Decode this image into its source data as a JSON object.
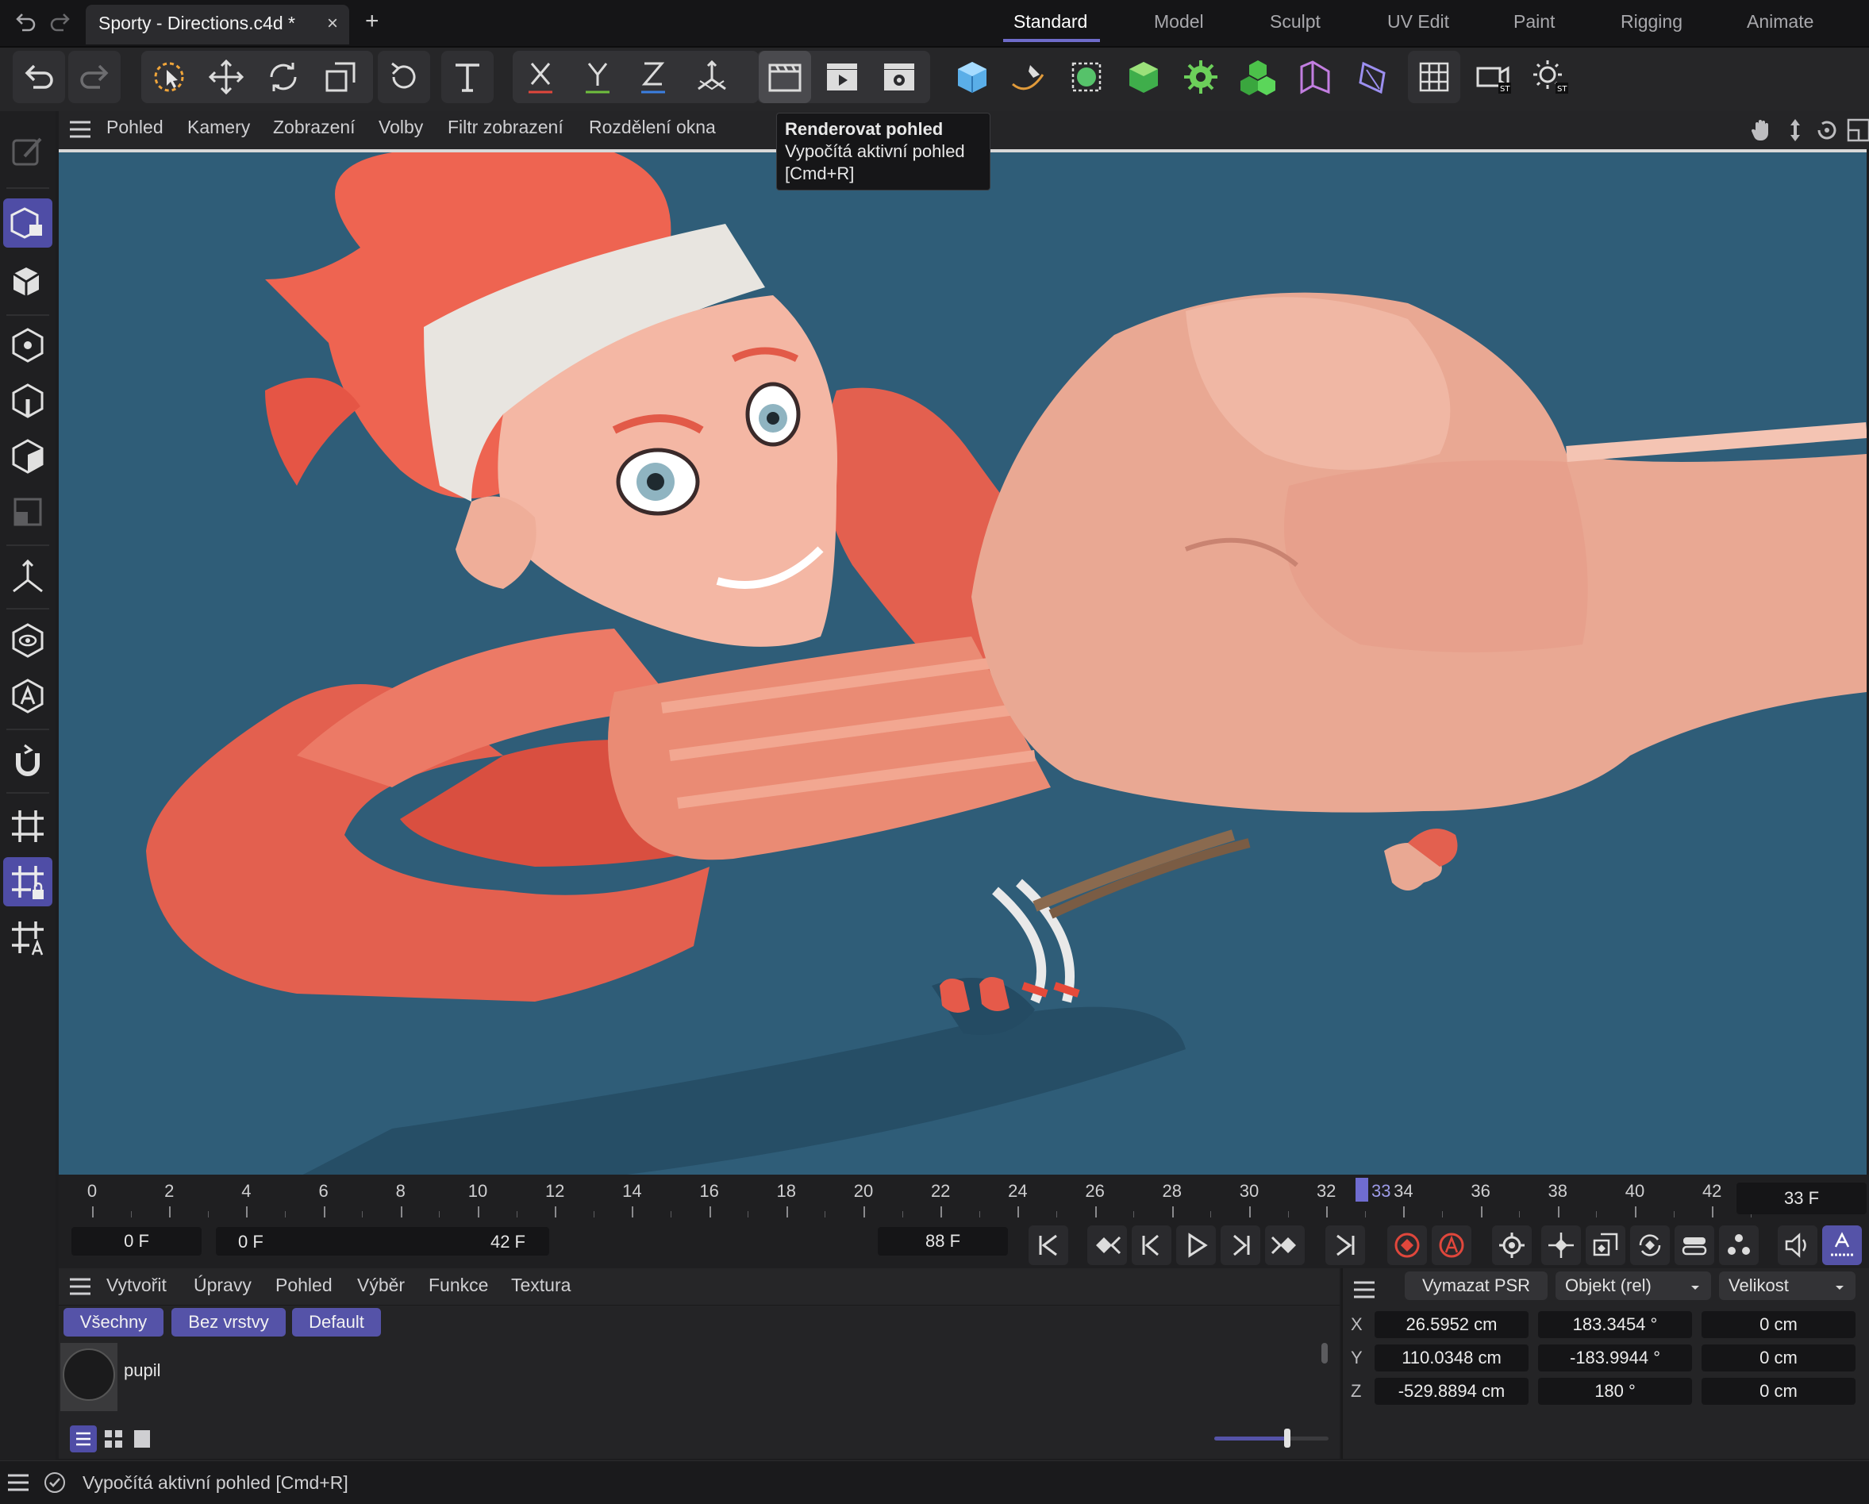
{
  "titlebar": {
    "doc_title": "Sporty - Directions.c4d *",
    "close_glyph": "×",
    "add_glyph": "+",
    "workspaces": [
      "Standard",
      "Model",
      "Sculpt",
      "UV Edit",
      "Paint",
      "Rigging",
      "Animate"
    ],
    "active_workspace": "Standard"
  },
  "viewport_menu": [
    "Pohled",
    "Kamery",
    "Zobrazení",
    "Volby",
    "Filtr zobrazení",
    "Rozdělení okna"
  ],
  "tooltip": {
    "title": "Renderovat pohled",
    "line1": "Vypočítá aktivní pohled",
    "line2": "[Cmd+R]"
  },
  "timeline": {
    "ticks": [
      "0",
      "2",
      "4",
      "6",
      "8",
      "10",
      "12",
      "14",
      "16",
      "18",
      "20",
      "22",
      "24",
      "26",
      "28",
      "30",
      "32",
      "34",
      "36",
      "38",
      "40",
      "42"
    ],
    "playhead_label": "33",
    "current_frame": "33 F",
    "start_field": "0 F",
    "range_start": "0 F",
    "range_end": "42 F",
    "max_field": "88 F"
  },
  "material_manager": {
    "menu": [
      "Vytvořit",
      "Úpravy",
      "Pohled",
      "Výběr",
      "Funkce",
      "Textura"
    ],
    "filters": [
      "Všechny",
      "Bez vrstvy",
      "Default"
    ],
    "items": [
      {
        "name": "pupil"
      }
    ]
  },
  "attributes": {
    "clear_button": "Vymazat PSR",
    "mode_select": "Objekt (rel)",
    "size_select": "Velikost",
    "rows": [
      {
        "axis": "X",
        "pos": "26.5952 cm",
        "rot": "183.3454 °",
        "size": "0 cm"
      },
      {
        "axis": "Y",
        "pos": "110.0348 cm",
        "rot": "-183.9944 °",
        "size": "0 cm"
      },
      {
        "axis": "Z",
        "pos": "-529.8894 cm",
        "rot": "180 °",
        "size": "0 cm"
      }
    ]
  },
  "status": {
    "text": "Vypočítá aktivní pohled [Cmd+R]"
  },
  "colors": {
    "accent": "#6e6bc9",
    "viewport_bg": "#2f5d78",
    "skin": "#e8a48f",
    "sweater": "#e3604f"
  }
}
